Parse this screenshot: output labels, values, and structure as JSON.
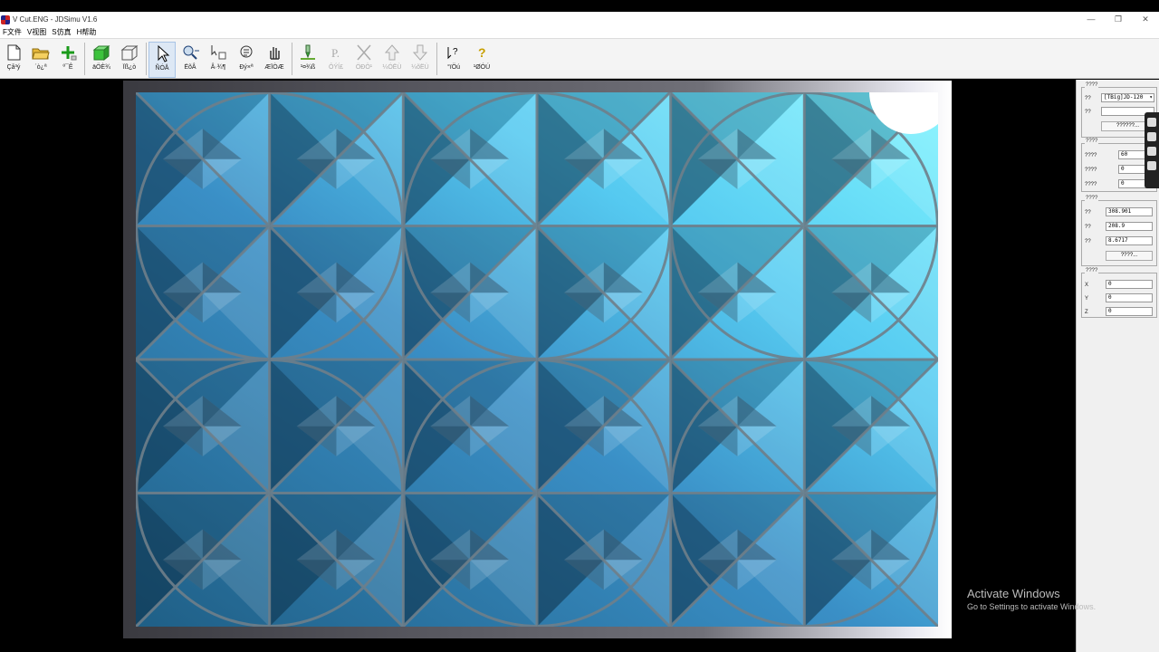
{
  "window": {
    "title": "V Cut.ENG - JDSimu V1.6",
    "minimize": "—",
    "maximize": "❐",
    "close": "✕"
  },
  "menu": [
    "F文件",
    "V视图",
    "S仿真",
    "H帮助"
  ],
  "toolbar": [
    {
      "label": "Çå³ý",
      "icon": "new-file-icon"
    },
    {
      "label": "´ò¿ª",
      "icon": "open-folder-icon"
    },
    {
      "label": "º¯Ê",
      "icon": "add-icon"
    },
    {
      "label": "äÖÈ¾",
      "icon": "solid-box-icon"
    },
    {
      "label": "Ïß¿ò",
      "icon": "wireframe-box-icon"
    },
    {
      "label": "ÑÓÅ",
      "icon": "select-arrow-icon"
    },
    {
      "label": "ËõÂ",
      "icon": "zoom-icon"
    },
    {
      "label": "Â·¾¶",
      "icon": "path-icon"
    },
    {
      "label": "Ðý×ª",
      "icon": "rotate-icon"
    },
    {
      "label": "ÆÏÒÆ",
      "icon": "pan-hand-icon"
    },
    {
      "label": "¹¤¾ß",
      "icon": "tool-bit-icon"
    },
    {
      "label": "ÔÝÍ£",
      "icon": "pause-icon"
    },
    {
      "label": "ÖÐÖ¹",
      "icon": "stop-icon"
    },
    {
      "label": "¼ÓËÙ",
      "icon": "speed-up-icon"
    },
    {
      "label": "¼õËÙ",
      "icon": "slow-down-icon"
    },
    {
      "label": "°ïÖú",
      "icon": "help-context-icon"
    },
    {
      "label": "¹ØÓÚ",
      "icon": "about-icon"
    }
  ],
  "panel": {
    "group1": {
      "title": "????",
      "label1": "??",
      "select": "[TBig]JD-120",
      "label2": "??",
      "input2": "",
      "button": "??????..."
    },
    "group2": {
      "title": "????",
      "rows": [
        {
          "label": "????",
          "value": "60"
        },
        {
          "label": "????",
          "value": "0"
        },
        {
          "label": "????",
          "value": "0"
        }
      ]
    },
    "group3": {
      "title": "????",
      "rows": [
        {
          "label": "??",
          "value": "308.901"
        },
        {
          "label": "??",
          "value": "208.9"
        },
        {
          "label": "??",
          "value": "8.6717"
        }
      ],
      "button": "????..."
    },
    "group4": {
      "title": "????",
      "rows": [
        {
          "label": "X",
          "value": "0"
        },
        {
          "label": "Y",
          "value": "0"
        },
        {
          "label": "Z",
          "value": "0"
        }
      ]
    }
  },
  "watermark": {
    "line1": "Activate Windows",
    "line2": "Go to Settings to activate Windows."
  }
}
